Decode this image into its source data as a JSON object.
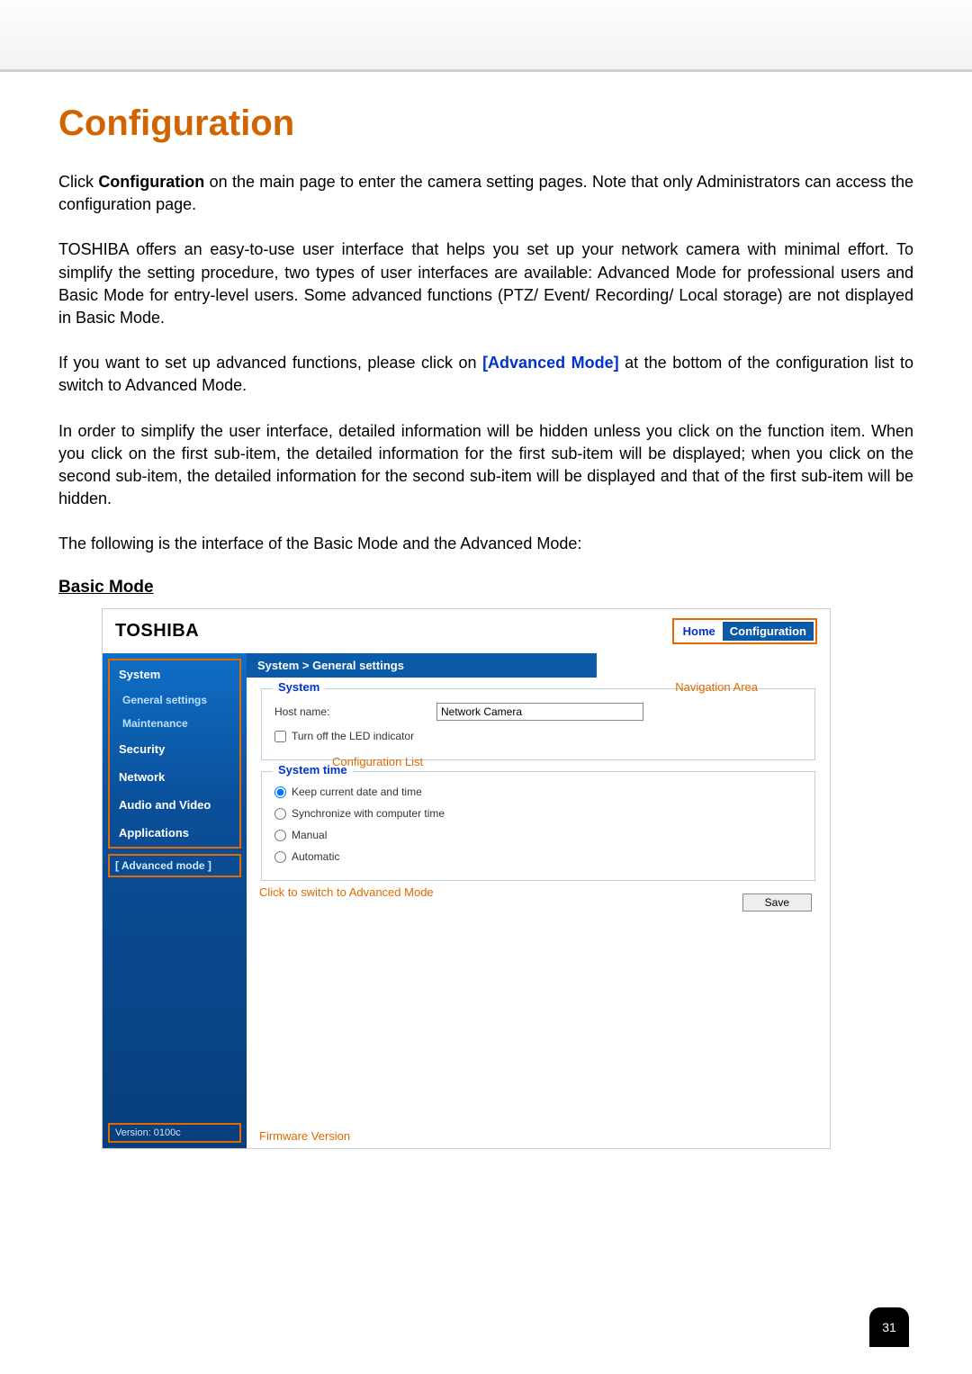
{
  "doc": {
    "title": "Configuration",
    "para1_a": "Click ",
    "para1_b": "Configuration",
    "para1_c": " on the main page to enter the camera setting pages. Note that only Administrators can access the configuration page.",
    "para2": "TOSHIBA offers an easy-to-use user interface that helps you set up your network camera with minimal effort. To simplify the setting procedure, two types of user interfaces are available: Advanced Mode for professional users and Basic Mode for entry-level users. Some advanced functions (PTZ/ Event/ Recording/ Local storage) are not displayed in Basic Mode.",
    "para3_a": "If you want to set up advanced functions, please click on ",
    "para3_b": "[Advanced Mode]",
    "para3_c": " at the bottom of the configuration list to switch to Advanced Mode.",
    "para4": "In order to simplify the user interface, detailed information will be hidden unless you click on the function item. When you click on the first sub-item, the detailed information for the first sub-item will be displayed; when you click on the second sub-item, the detailed information for the second sub-item will be displayed and that of the first sub-item will be hidden.",
    "para5": "The following is the interface of the Basic Mode and the Advanced Mode:",
    "subhead": "Basic Mode",
    "page_number": "31"
  },
  "ui": {
    "brand": "TOSHIBA",
    "nav_home": "Home",
    "nav_config": "Configuration",
    "breadcrumb": "System  >  General settings",
    "sidebar": {
      "system": "System",
      "general": "General settings",
      "maintenance": "Maintenance",
      "security": "Security",
      "network": "Network",
      "audio_video": "Audio and Video",
      "applications": "Applications",
      "advanced": "[ Advanced mode ]",
      "version": "Version: 0100c"
    },
    "panel_system": {
      "legend": "System",
      "host_label": "Host name:",
      "host_value": "Network Camera",
      "led_label": "Turn off the LED indicator"
    },
    "panel_time": {
      "legend": "System time",
      "opt_keep": "Keep current date and time",
      "opt_sync": "Synchronize with computer time",
      "opt_manual": "Manual",
      "opt_auto": "Automatic"
    },
    "save": "Save"
  },
  "annotations": {
    "nav_area": "Navigation Area",
    "config_list": "Configuration List",
    "switch_adv": "Click to switch to Advanced Mode",
    "fw_version": "Firmware Version"
  }
}
